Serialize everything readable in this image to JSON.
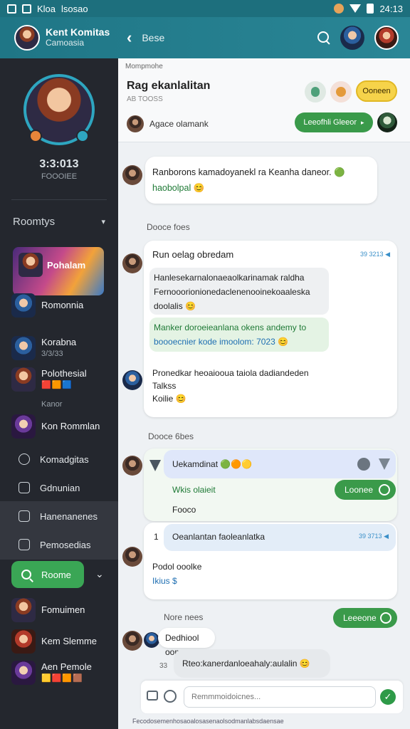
{
  "status_bar": {
    "left_text": "Kloa",
    "left_text2": "lsosao",
    "time": "24:13"
  },
  "header": {
    "user_name": "Kent Komitas",
    "user_sub": "Camoasia",
    "back_glyph": "‹",
    "title": "Bese"
  },
  "sidebar": {
    "profile_name": "3:3:013",
    "profile_sub": "FOOOIEE",
    "section_label": "Roomtys",
    "rooms": [
      {
        "name": "Pohalam",
        "sub": ""
      },
      {
        "name": "Romonnia",
        "sub": ""
      },
      {
        "name": "Korabna",
        "sub": "3/3/33"
      },
      {
        "name": "Polothesial",
        "sub": ""
      },
      {
        "name": "Kon Rommlan",
        "sub": ""
      }
    ],
    "room_emojis": "🟥🟧🟦",
    "subtitle": "Kanor",
    "nav": [
      {
        "label": "Komadgitas"
      },
      {
        "label": "Gdnunian"
      },
      {
        "label": "Hanenanenes"
      },
      {
        "label": "Pemosedias"
      }
    ],
    "search_label": "Roome",
    "bottom_rooms": [
      {
        "name": "Fomuimen",
        "sub": ""
      },
      {
        "name": "Kem Slemme",
        "sub": ""
      },
      {
        "name": "Aen Pemole",
        "sub": ""
      }
    ],
    "bottom_emojis": "🟨🟥🟧🟫"
  },
  "chat": {
    "label": "Mompmohe",
    "title": "Rag ekanlalitan",
    "members": "AB TOOSS",
    "yellow_button": "Ooneen",
    "owner": "Agace olamank",
    "green_button": "Leeofhli Gleeor",
    "msg1": {
      "line1": "Ranborons kamadoyanekl ra Keanha daneor. 🟢",
      "line2": "haobolpal 😊"
    },
    "day1": "Dooce foes",
    "card1": {
      "title": "Run oelag obredam",
      "time": "39 3213 ◀",
      "grey_lines": [
        "Hanlesekarnalonaeaolkarinamak raldha",
        "Fernooorionionedaclenenooinekoaaleska",
        "doolalis 😊"
      ],
      "green_lines": [
        "Manker doroeieanlana okens andemy to",
        "boooecnier kode imoolom: 7023 😊"
      ],
      "msg_lines": [
        "Pronedkar heoaiooua taiola dadiandeden",
        "Talkss",
        "Koilie 😊"
      ]
    },
    "day2": "Dooce 6bes",
    "card2": {
      "blue_text": "Uekamdinat 🟢🟠🟡",
      "green_label": "Wkis olaieit",
      "green_button": "Loonee",
      "sub_text": "Fooco"
    },
    "card3": {
      "num": "1",
      "blue_text": "Oeanlantan faoleanlatka",
      "time": "39 3713 ◀",
      "line1": "Podol ooolke",
      "line2": "Ikius $"
    },
    "day3": "Nore nees",
    "right_button": "Leeeone",
    "last_name": "Dedhiool oome",
    "last_index": "33",
    "last_msg": "Rteo:kanerdanloeahaly:aulalin 😊"
  },
  "composer": {
    "placeholder": "Remmmoidoicnes..."
  },
  "footer_note": "Fecodosemenhosaoalosasenaolsodmanlabsdaensae"
}
